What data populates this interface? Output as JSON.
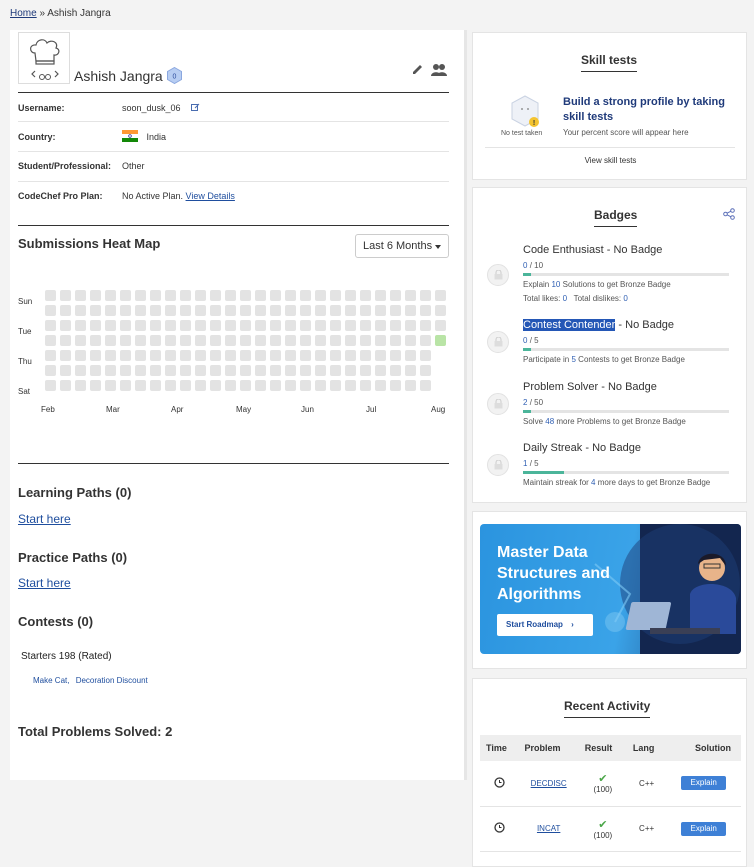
{
  "breadcrumb": {
    "home": "Home",
    "separator": "»",
    "current": "Ashish Jangra"
  },
  "profile": {
    "name": "Ashish Jangra",
    "rating_badge": "0",
    "fields": [
      {
        "label": "Username:",
        "value": "soon_dusk_06"
      },
      {
        "label": "Country:",
        "value": "India"
      },
      {
        "label": "Student/Professional:",
        "value": "Other"
      },
      {
        "label": "CodeChef Pro Plan:",
        "value": "No Active Plan.",
        "link": "View Details"
      }
    ]
  },
  "heatmap": {
    "title": "Submissions Heat Map",
    "range_select": "Last 6 Months",
    "day_labels": [
      "Sun",
      "Tue",
      "Thu",
      "Sat"
    ],
    "month_labels": [
      "Feb",
      "Mar",
      "Apr",
      "May",
      "Jun",
      "Jul",
      "Aug"
    ],
    "active_cells": [
      {
        "week": 26,
        "day": 3
      }
    ]
  },
  "learning_paths": {
    "title": "Learning Paths (0)",
    "link": "Start here"
  },
  "practice_paths": {
    "title": "Practice Paths (0)",
    "link": "Start here"
  },
  "contests": {
    "title": "Contests (0)",
    "name": "Starters 198 (Rated)",
    "problems": [
      "Make Cat,",
      "Decoration Discount"
    ]
  },
  "total_solved": "Total Problems Solved: 2",
  "skill_tests": {
    "title": "Skill tests",
    "not_taken": "No test taken",
    "headline": "Build a strong profile by taking skill tests",
    "sub": "Your percent score will appear here",
    "link": "View skill tests"
  },
  "badges": {
    "title": "Badges",
    "items": [
      {
        "title": "Code Enthusiast - No Badge",
        "count": "0",
        "total": "/ 10",
        "progress": 0,
        "desc_pre": "Explain",
        "desc_num": "10",
        "desc_post": "Solutions to get Bronze Badge",
        "extra_likes_label": "Total likes:",
        "extra_likes": "0",
        "extra_dislikes_label": "Total dislikes:",
        "extra_dislikes": "0"
      },
      {
        "title_hl": "Contest Contender",
        "title_rest": " - No Badge",
        "count": "0",
        "total": "/ 5",
        "progress": 0,
        "desc_pre": "Participate in",
        "desc_num": "5",
        "desc_post": "Contests to get Bronze Badge"
      },
      {
        "title": "Problem Solver - No Badge",
        "count": "2",
        "total": "/ 50",
        "progress": 0.04,
        "desc_pre": "Solve",
        "desc_num": "48",
        "desc_post": "more Problems to get Bronze Badge"
      },
      {
        "title": "Daily Streak - No Badge",
        "count": "1",
        "total": "/ 5",
        "progress": 0.2,
        "desc_pre": "Maintain streak for",
        "desc_num": "4",
        "desc_post": "more days to get Bronze Badge"
      }
    ]
  },
  "promo": {
    "title": "Master Data Structures and Algorithms",
    "button": "Start Roadmap"
  },
  "recent_activity": {
    "title": "Recent Activity",
    "columns": [
      "Time",
      "Problem",
      "Result",
      "Lang",
      "Solution"
    ],
    "rows": [
      {
        "problem": "DECDISC",
        "result": "(100)",
        "lang": "C++",
        "solution": "Explain"
      },
      {
        "problem": "INCAT",
        "result": "(100)",
        "lang": "C++",
        "solution": "Explain"
      }
    ]
  },
  "colors": {
    "accent": "#3e80d6",
    "link": "#1f4e9e",
    "progress": "#4bb59a",
    "heat_empty": "#e3e3e3",
    "heat_active": "#b9e4a6"
  }
}
